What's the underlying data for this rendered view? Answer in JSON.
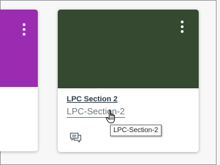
{
  "cards": [
    {
      "hero_color": "#9b2bb1",
      "menu_icon": "kebab-menu-icon"
    },
    {
      "hero_color": "#344930",
      "menu_icon": "kebab-menu-icon",
      "title": "LPC Section 2",
      "code": "LPC-Section-2",
      "actions": [
        "announcements-icon"
      ]
    }
  ],
  "tooltip": {
    "text": "LPC-Section-2"
  },
  "cursor": "hand-pointer-cursor"
}
